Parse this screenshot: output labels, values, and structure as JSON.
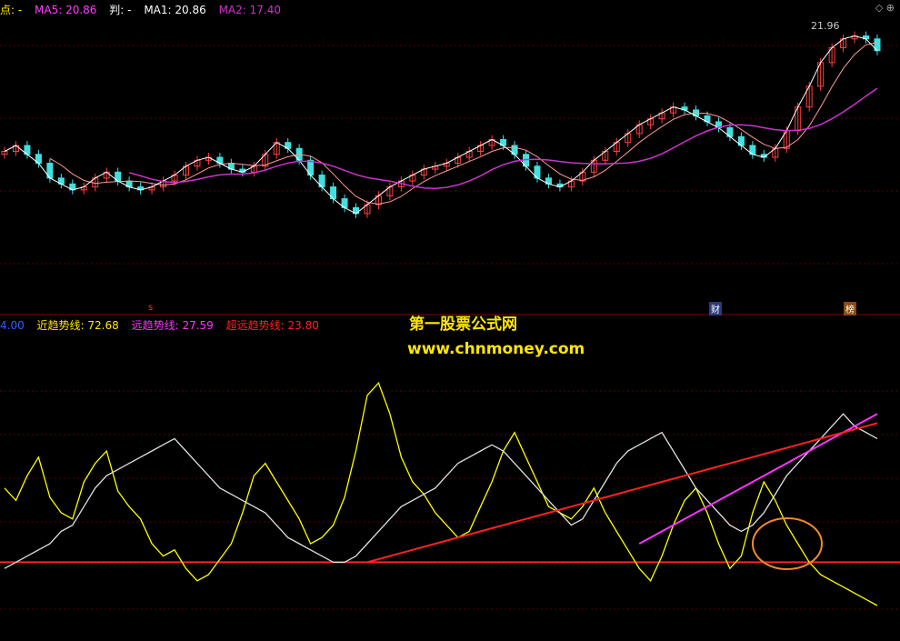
{
  "top_legend": {
    "prefix": "点: -",
    "ma5": "MA5: 20.86",
    "judge": "判: -",
    "ma1": "MA1: 20.86",
    "ma2": "MA2: 17.40",
    "ma5_color": "#ff3cff",
    "ma1_color": "#ffffff",
    "ma2_color": "#cc33cc"
  },
  "bottom_legend": {
    "first": "4.00",
    "near": "近趋势线: 72.68",
    "far": "远趋势线: 27.59",
    "ultra": "超远趋势线: 23.80"
  },
  "watermark": {
    "line1": "第一股票公式网",
    "line2": "www.chnmoney.com"
  },
  "tags": {
    "s": "s",
    "cai": "财",
    "bang": "榜"
  },
  "icons": {
    "diamond": "◇",
    "plus": "⊕"
  },
  "chart_data": [
    {
      "type": "candlestick",
      "peak_label": "21.96",
      "ylim": [
        14.0,
        22.6
      ],
      "close": [
        18.1,
        18.3,
        18.0,
        17.7,
        17.2,
        17.0,
        16.8,
        16.9,
        17.2,
        17.4,
        17.1,
        16.9,
        16.8,
        16.9,
        17.1,
        17.3,
        17.6,
        17.8,
        17.9,
        17.7,
        17.5,
        17.4,
        17.6,
        18.0,
        18.4,
        18.2,
        17.8,
        17.3,
        16.9,
        16.5,
        16.2,
        16.0,
        16.3,
        16.6,
        16.9,
        17.1,
        17.3,
        17.5,
        17.6,
        17.7,
        17.9,
        18.1,
        18.3,
        18.5,
        18.3,
        18.0,
        17.6,
        17.2,
        17.0,
        16.9,
        17.1,
        17.4,
        17.8,
        18.1,
        18.4,
        18.7,
        19.0,
        19.2,
        19.4,
        19.6,
        19.5,
        19.3,
        19.1,
        18.9,
        18.6,
        18.3,
        18.0,
        17.9,
        18.2,
        18.8,
        19.6,
        20.3,
        21.1,
        21.6,
        21.9,
        22.0,
        21.9,
        21.5
      ]
    },
    {
      "type": "line",
      "series": [
        {
          "name": "近趋势线",
          "color": "#ffff00",
          "values": [
            48,
            44,
            52,
            58,
            45,
            40,
            38,
            50,
            56,
            60,
            47,
            42,
            38,
            30,
            26,
            28,
            22,
            18,
            20,
            25,
            30,
            40,
            52,
            56,
            50,
            44,
            38,
            30,
            32,
            36,
            45,
            60,
            78,
            82,
            72,
            58,
            50,
            46,
            40,
            36,
            32,
            34,
            42,
            50,
            60,
            66,
            58,
            50,
            42,
            40,
            38,
            42,
            48,
            40,
            34,
            28,
            22,
            18,
            26,
            36,
            44,
            48,
            40,
            30,
            22,
            26,
            40,
            50,
            44,
            36,
            30,
            24,
            20,
            18,
            16,
            14,
            12,
            10
          ]
        },
        {
          "name": "白线",
          "color": "#e0e0e0",
          "values": [
            22,
            24,
            26,
            28,
            30,
            34,
            36,
            42,
            48,
            52,
            54,
            56,
            58,
            60,
            62,
            64,
            60,
            56,
            52,
            48,
            46,
            44,
            42,
            40,
            36,
            32,
            30,
            28,
            26,
            24,
            24,
            26,
            30,
            34,
            38,
            42,
            44,
            46,
            48,
            52,
            56,
            58,
            60,
            62,
            60,
            56,
            52,
            48,
            44,
            40,
            36,
            38,
            44,
            50,
            56,
            60,
            62,
            64,
            66,
            60,
            54,
            48,
            44,
            40,
            36,
            34,
            36,
            40,
            46,
            52,
            56,
            60,
            64,
            68,
            72,
            68,
            66,
            64
          ]
        },
        {
          "name": "远趋势线",
          "color": "#ff33ff",
          "values": [
            null,
            null,
            null,
            null,
            null,
            null,
            null,
            null,
            null,
            null,
            null,
            null,
            null,
            null,
            null,
            null,
            null,
            null,
            null,
            null,
            null,
            null,
            null,
            null,
            null,
            null,
            null,
            null,
            null,
            null,
            null,
            null,
            null,
            null,
            null,
            null,
            null,
            null,
            null,
            null,
            null,
            null,
            null,
            null,
            null,
            null,
            null,
            null,
            null,
            null,
            null,
            null,
            null,
            null,
            null,
            null,
            30,
            32,
            34,
            36,
            38,
            40,
            42,
            44,
            46,
            48,
            50,
            52,
            54,
            56,
            58,
            60,
            62,
            64,
            66,
            68,
            70,
            72
          ]
        },
        {
          "name": "超远趋势线",
          "color": "#ff2020",
          "values": [
            null,
            null,
            null,
            null,
            null,
            null,
            null,
            null,
            null,
            null,
            null,
            null,
            null,
            null,
            null,
            null,
            null,
            null,
            null,
            null,
            null,
            null,
            null,
            null,
            null,
            null,
            null,
            null,
            null,
            null,
            null,
            null,
            24,
            25,
            26,
            27,
            28,
            29,
            30,
            31,
            32,
            33,
            34,
            35,
            36,
            37,
            38,
            39,
            40,
            41,
            42,
            43,
            44,
            45,
            46,
            47,
            48,
            49,
            50,
            51,
            52,
            53,
            54,
            55,
            56,
            57,
            58,
            59,
            60,
            61,
            62,
            63,
            64,
            65,
            66,
            67,
            68,
            69
          ]
        }
      ]
    }
  ]
}
